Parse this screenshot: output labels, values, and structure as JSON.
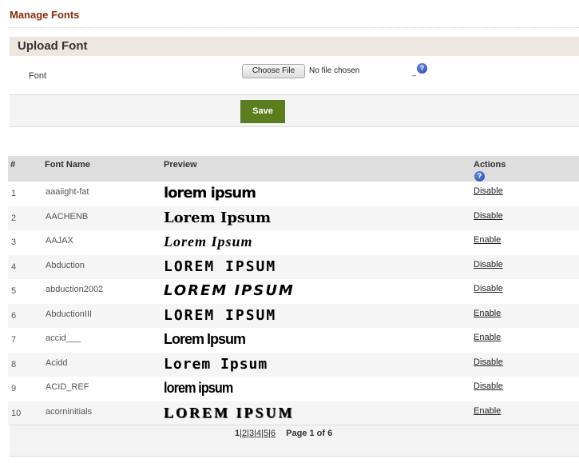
{
  "page": {
    "title": "Manage Fonts"
  },
  "upload": {
    "heading": "Upload Font",
    "font_label": "Font",
    "choose_file_label": "Choose File",
    "no_file_text": "No file chosen",
    "help_marker": "_",
    "help_glyph": "?",
    "save_label": "Save"
  },
  "table": {
    "columns": {
      "num": "#",
      "name": "Font Name",
      "preview": "Preview",
      "actions": "Actions"
    },
    "rows": [
      {
        "num": "1",
        "name": "aaaiight-fat",
        "preview": "lorem ipsum",
        "action": "Disable"
      },
      {
        "num": "2",
        "name": "AACHENB",
        "preview": "Lorem Ipsum",
        "action": "Disable"
      },
      {
        "num": "3",
        "name": "AAJAX",
        "preview": "Lorem Ipsum",
        "action": "Enable"
      },
      {
        "num": "4",
        "name": "Abduction",
        "preview": "LOREM IPSUM",
        "action": "Disable"
      },
      {
        "num": "5",
        "name": "abduction2002",
        "preview": "LOREM IPSUM",
        "action": "Disable"
      },
      {
        "num": "6",
        "name": "AbductionIII",
        "preview": "LOREM IPSUM",
        "action": "Enable"
      },
      {
        "num": "7",
        "name": "accid___",
        "preview": "Lorem Ipsum",
        "action": "Enable"
      },
      {
        "num": "8",
        "name": "Acidd",
        "preview": "Lorem Ipsum",
        "action": "Disable"
      },
      {
        "num": "9",
        "name": "ACID_REF",
        "preview": "lorem ipsum",
        "action": "Disable"
      },
      {
        "num": "10",
        "name": "acorninitials",
        "preview": "LOREM IPSUM",
        "action": "Enable"
      }
    ]
  },
  "pagination": {
    "pages": [
      "1",
      "2",
      "3",
      "4",
      "5",
      "6"
    ],
    "current": "1",
    "separator": "|",
    "page_info": "Page 1 of 6"
  },
  "colors": {
    "title": "#8a2a0b",
    "save_button": "#5a7d1d",
    "header_bg": "#dedede",
    "help_icon": "#1e3fa8"
  }
}
